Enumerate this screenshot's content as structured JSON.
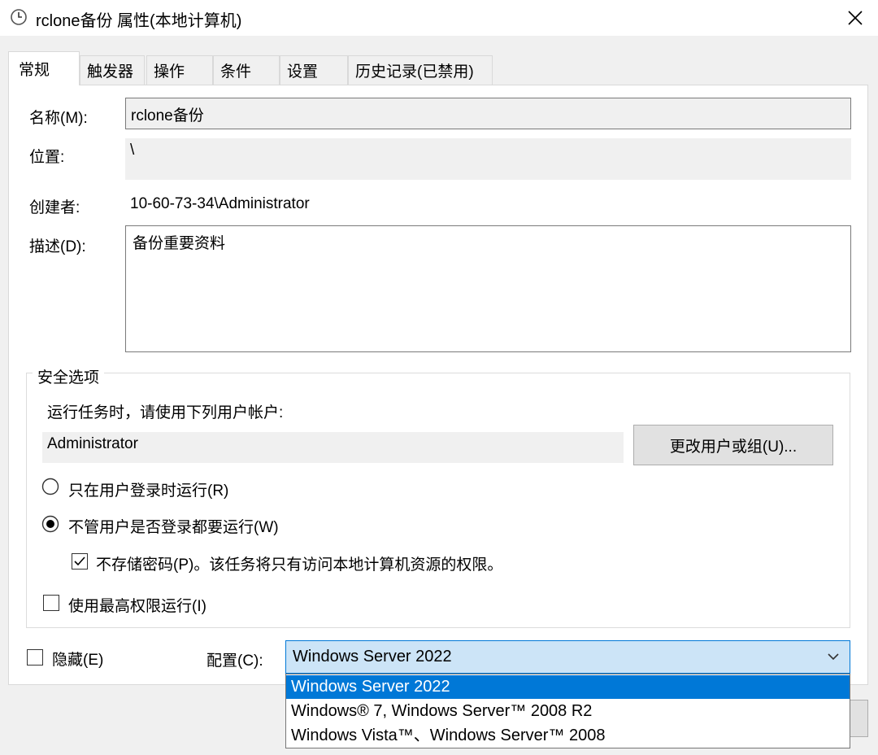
{
  "window": {
    "title": "rclone备份 属性(本地计算机)"
  },
  "tabs": [
    "常规",
    "触发器",
    "操作",
    "条件",
    "设置",
    "历史记录(已禁用)"
  ],
  "general": {
    "name_label": "名称(M):",
    "name_value": "rclone备份",
    "location_label": "位置:",
    "location_value": "\\",
    "author_label": "创建者:",
    "author_value": "10-60-73-34\\Administrator",
    "description_label": "描述(D):",
    "description_value": "备份重要资料"
  },
  "security": {
    "title": "安全选项",
    "run_as_prompt": "运行任务时，请使用下列用户帐户:",
    "user_account": "Administrator",
    "change_user_button": "更改用户或组(U)...",
    "option_logged_on": "只在用户登录时运行(R)",
    "option_whether_logged_on": "不管用户是否登录都要运行(W)",
    "selected_option": "option_whether_logged_on",
    "do_not_store_password": "不存储密码(P)。该任务将只有访问本地计算机资源的权限。",
    "do_not_store_password_checked": true,
    "run_highest_privileges": "使用最高权限运行(I)",
    "run_highest_privileges_checked": false
  },
  "hidden_label": "隐藏(E)",
  "hidden_checked": false,
  "configure_for": {
    "label": "配置(C):",
    "selected": "Windows Server 2022",
    "options": [
      "Windows Server 2022",
      "Windows® 7, Windows Server™ 2008 R2",
      "Windows Vista™、Windows Server™ 2008"
    ]
  },
  "colors": {
    "accent": "#0078d7",
    "selection_bg": "#cce4f7"
  }
}
